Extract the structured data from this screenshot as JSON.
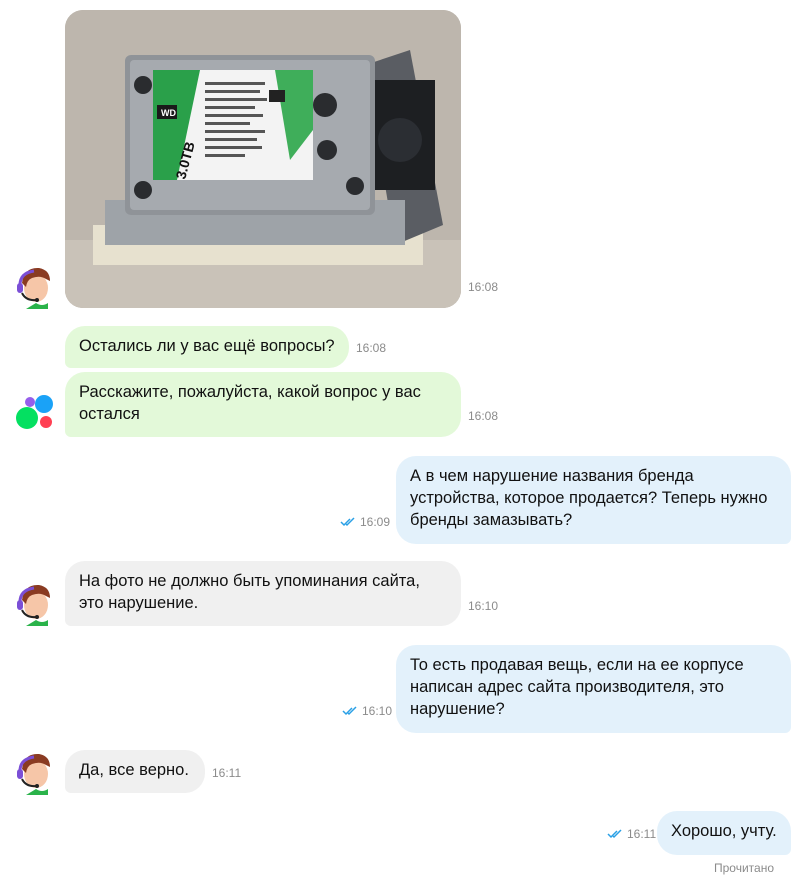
{
  "messages": [
    {
      "id": "photo",
      "time": "16:08"
    },
    {
      "id": "m1",
      "text": "Остались ли у вас ещё вопросы?",
      "time": "16:08"
    },
    {
      "id": "m2",
      "text": "Расскажите, пожалуйста, какой вопрос у вас остался",
      "time": "16:08"
    },
    {
      "id": "m3",
      "text": "А в чем нарушение названия бренда устройства, которое продается? Теперь нужно бренды замазывать?",
      "time": "16:09"
    },
    {
      "id": "m4",
      "text": "На фото не должно быть упоминания сайта, это нарушение.",
      "time": "16:10"
    },
    {
      "id": "m5",
      "text": "То есть продавая вещь, если на ее корпусе написан адрес сайта производителя, это нарушение?",
      "time": "16:10"
    },
    {
      "id": "m6",
      "text": "Да, все верно.",
      "time": "16:11"
    },
    {
      "id": "m7",
      "text": "Хорошо, учту.",
      "time": "16:11"
    }
  ],
  "read_status": "Прочитано",
  "photo_label": {
    "capacity": "3.0TB",
    "brand": "WD"
  },
  "colors": {
    "outgoing_bubble": "#e3f1fb",
    "bot_bubble": "#e3f9d9",
    "agent_bubble": "#f0f0f0",
    "read_ticks": "#2aa0e6",
    "timestamp": "#8b8b8b"
  }
}
